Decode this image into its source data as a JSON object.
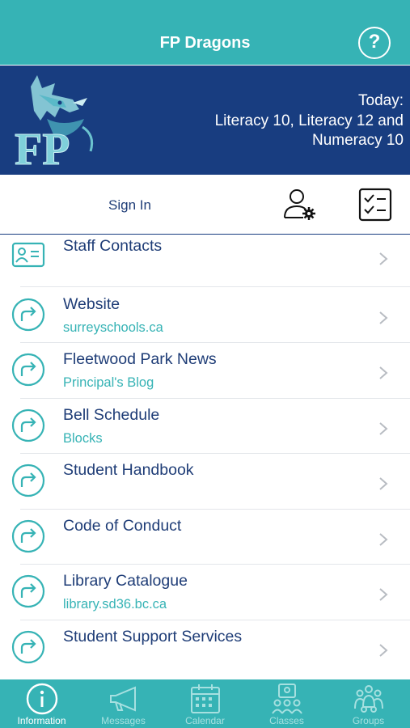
{
  "header": {
    "title": "FP Dragons"
  },
  "help_icon": "question-circle-icon",
  "banner": {
    "logo_text": "FP",
    "today_lines": [
      "Today:",
      "Literacy 10, Literacy 12 and",
      "Numeracy 10"
    ]
  },
  "account": {
    "signin_label": "Sign In"
  },
  "menu": [
    {
      "title": "Staff Contacts",
      "subtitle": "",
      "icon": "contact-card-icon"
    },
    {
      "title": "Website",
      "subtitle": "surreyschools.ca",
      "icon": "share-arrow-icon"
    },
    {
      "title": "Fleetwood Park News",
      "subtitle": "Principal's Blog",
      "icon": "share-arrow-icon"
    },
    {
      "title": "Bell Schedule",
      "subtitle": "Blocks",
      "icon": "share-arrow-icon"
    },
    {
      "title": "Student Handbook",
      "subtitle": "",
      "icon": "share-arrow-icon"
    },
    {
      "title": "Code of Conduct",
      "subtitle": "",
      "icon": "share-arrow-icon"
    },
    {
      "title": "Library Catalogue",
      "subtitle": "library.sd36.bc.ca",
      "icon": "share-arrow-icon"
    },
    {
      "title": "Student Support Services",
      "subtitle": "",
      "icon": "share-arrow-icon"
    }
  ],
  "tabs": [
    {
      "label": "Information",
      "icon": "info-icon",
      "active": true
    },
    {
      "label": "Messages",
      "icon": "megaphone-icon",
      "active": false
    },
    {
      "label": "Calendar",
      "icon": "calendar-icon",
      "active": false
    },
    {
      "label": "Classes",
      "icon": "classes-icon",
      "active": false
    },
    {
      "label": "Groups",
      "icon": "groups-icon",
      "active": false
    }
  ],
  "colors": {
    "teal": "#36b3b5",
    "navy": "#183d80",
    "text_navy": "#1f3d77"
  }
}
